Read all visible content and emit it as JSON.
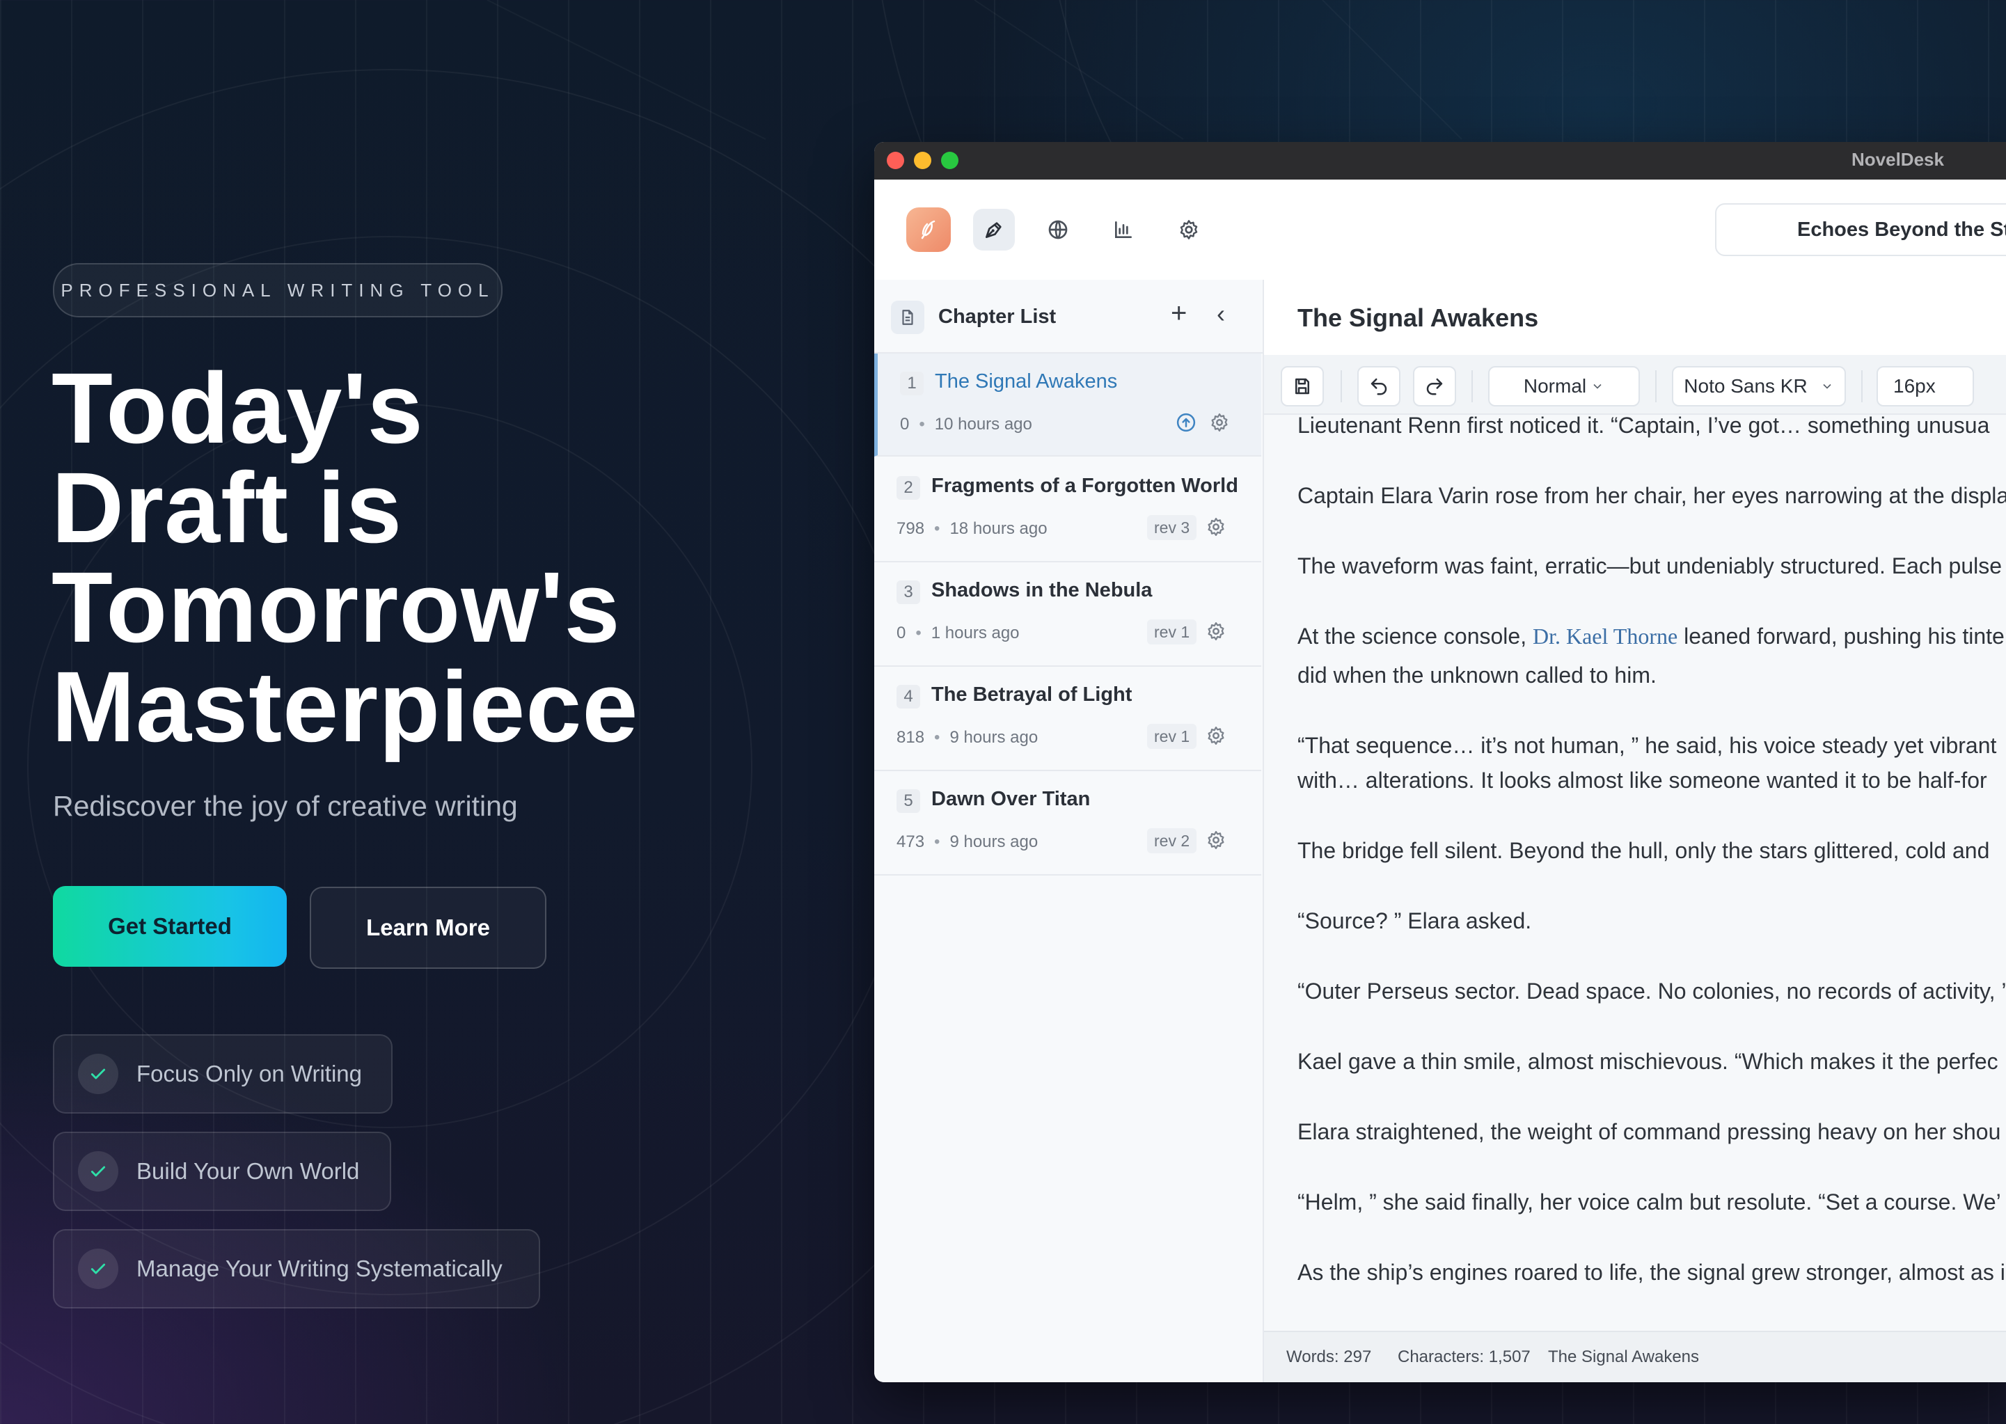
{
  "hero": {
    "badge": "PROFESSIONAL WRITING TOOL",
    "headline": [
      "Today's",
      "Draft is",
      "Tomorrow's",
      "Masterpiece"
    ],
    "subtitle": "Rediscover the joy of creative writing",
    "primary_button": "Get Started",
    "secondary_button": "Learn More",
    "features": [
      "Focus Only on Writing",
      "Build Your Own World",
      "Manage Your Writing Systematically"
    ]
  },
  "app": {
    "window_title": "NovelDesk",
    "project_title": "Echoes Beyond the Sta",
    "toolbar_icons": [
      "pen-nib-icon",
      "globe-icon",
      "bar-chart-icon",
      "gear-icon"
    ],
    "sidebar": {
      "title": "Chapter List",
      "chapters": [
        {
          "num": "1",
          "title": "The Signal Awakens",
          "words": "0",
          "time": "10 hours ago",
          "rev": ""
        },
        {
          "num": "2",
          "title": "Fragments of a Forgotten World",
          "words": "798",
          "time": "18 hours ago",
          "rev": "rev 3"
        },
        {
          "num": "3",
          "title": "Shadows in the Nebula",
          "words": "0",
          "time": "1 hours ago",
          "rev": "rev 1"
        },
        {
          "num": "4",
          "title": "The Betrayal of Light",
          "words": "818",
          "time": "9 hours ago",
          "rev": "rev 1"
        },
        {
          "num": "5",
          "title": "Dawn Over Titan",
          "words": "473",
          "time": "9 hours ago",
          "rev": "rev 2"
        }
      ]
    },
    "editor": {
      "title": "The Signal Awakens",
      "format": {
        "style": "Normal",
        "font": "Noto Sans KR",
        "size": "16px"
      },
      "paragraphs": {
        "p0": "Lieutenant Renn first noticed it. “Captain, I’ve got… something unusua",
        "p1": "Captain Elara Varin rose from her chair, her eyes narrowing at the displa",
        "p2": "The waveform was faint, erratic—but undeniably structured. Each pulse",
        "p3a": "At the science console,",
        "p3name": "Dr. Kael Thorne",
        "p3b": "leaned forward, pushing his tinte",
        "p3c": "did when the unknown called to him.",
        "p4a": "“That sequence… it’s not human, ” he said, his voice steady yet vibrant",
        "p4b": "with… alterations. It looks almost like someone wanted it to be half-for",
        "p5": "The bridge fell silent. Beyond the hull, only the stars glittered, cold and",
        "p6": "“Source? ” Elara asked.",
        "p7": "“Outer Perseus sector. Dead space. No colonies, no records of activity, ’",
        "p8": "Kael gave a thin smile, almost mischievous. “Which makes it the perfec",
        "p9": "Elara straightened, the weight of command pressing heavy on her shou",
        "p10": "“Helm, ” she said finally, her voice calm but resolute. “Set a course. We’",
        "p11": "As the ship’s engines roared to life, the signal grew stronger, almost as i"
      },
      "status": {
        "words": "Words: 297",
        "characters": "Characters: 1,507",
        "chapter": "The Signal Awakens"
      }
    }
  },
  "colors": {
    "accent_gradient_start": "#10d9a0",
    "accent_gradient_end": "#13b5f0",
    "check": "#2ee0a8",
    "link": "#3b6ea5",
    "active_chapter": "#2f78b6"
  }
}
